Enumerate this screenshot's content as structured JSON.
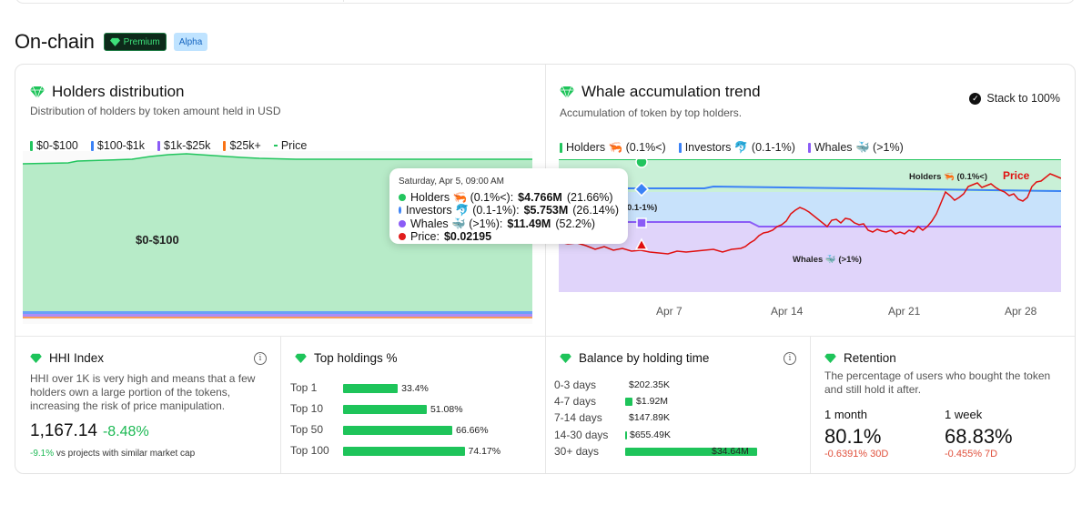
{
  "page": {
    "title": "On-chain",
    "badges": {
      "premium": "Premium",
      "alpha": "Alpha"
    }
  },
  "holders": {
    "title": "Holders distribution",
    "subtitle": "Distribution of holders by token amount held in USD",
    "legend": [
      {
        "label": "$0-$100",
        "color": "#22c55e"
      },
      {
        "label": "$100-$1k",
        "color": "#3b82f6"
      },
      {
        "label": "$1k-$25k",
        "color": "#8b5cf6"
      },
      {
        "label": "$25k+",
        "color": "#f97316"
      },
      {
        "label": "Price",
        "color": "#22c55e"
      }
    ],
    "area_label": "$0-$100"
  },
  "tooltip": {
    "date": "Saturday, Apr 5, 09:00 AM",
    "rows": [
      {
        "label": "Holders 🦐 (0.1%<):",
        "value": "$4.766M",
        "pct": "(21.66%)",
        "color": "#22c55e"
      },
      {
        "label": "Investors 🐬 (0.1-1%):",
        "value": "$5.753M",
        "pct": "(26.14%)",
        "color": "#3b82f6"
      },
      {
        "label": "Whales 🐳 (>1%):",
        "value": "$11.49M",
        "pct": "(52.2%)",
        "color": "#8b5cf6"
      },
      {
        "label": "Price:",
        "value": "$0.02195",
        "pct": "",
        "color": "#e11d1d"
      }
    ]
  },
  "whale": {
    "title": "Whale accumulation trend",
    "subtitle": "Accumulation of token by top holders.",
    "stack_label": "Stack to 100%",
    "legend": [
      {
        "label": "Holders 🦐 (0.1%<)",
        "color": "#22c55e"
      },
      {
        "label": "Investors 🐬 (0.1-1%)",
        "color": "#3b82f6"
      },
      {
        "label": "Whales 🐳 (>1%)",
        "color": "#8b5cf6"
      }
    ],
    "labels": {
      "holders": "Holders 🦐 (0.1%<)",
      "price": "Price",
      "investors": "0.1-1%)",
      "whales": "Whales 🐳 (>1%)"
    },
    "xticks": [
      "Apr 7",
      "Apr 14",
      "Apr 21",
      "Apr 28"
    ]
  },
  "hhi": {
    "title": "HHI Index",
    "description": "HHI over 1K is very high and means that a few holders own a large portion of the tokens, increasing the risk of price manipulation.",
    "value": "1,167.14",
    "change": "-8.48%",
    "compare_value": "-9.1%",
    "compare_text": "vs projects with similar market cap"
  },
  "top_holdings": {
    "title": "Top holdings %",
    "items": [
      {
        "label": "Top 1",
        "value": "33.4%",
        "pct": 33.4
      },
      {
        "label": "Top 10",
        "value": "51.08%",
        "pct": 51.08
      },
      {
        "label": "Top 50",
        "value": "66.66%",
        "pct": 66.66
      },
      {
        "label": "Top 100",
        "value": "74.17%",
        "pct": 74.17
      }
    ]
  },
  "balance": {
    "title": "Balance by holding time",
    "items": [
      {
        "label": "0-3 days",
        "value": "$202.35K",
        "amount": 0.20235
      },
      {
        "label": "4-7 days",
        "value": "$1.92M",
        "amount": 1.92
      },
      {
        "label": "7-14 days",
        "value": "$147.89K",
        "amount": 0.14789
      },
      {
        "label": "14-30 days",
        "value": "$655.49K",
        "amount": 0.65549
      },
      {
        "label": "30+ days",
        "value": "$34.64M",
        "amount": 34.64
      }
    ]
  },
  "retention": {
    "title": "Retention",
    "description": "The percentage of users who bought the token and still hold it after.",
    "periods": [
      {
        "label": "1 month",
        "value": "80.1%",
        "change": "-0.6391% 30D"
      },
      {
        "label": "1 week",
        "value": "68.83%",
        "change": "-0.455% 7D"
      }
    ]
  }
}
